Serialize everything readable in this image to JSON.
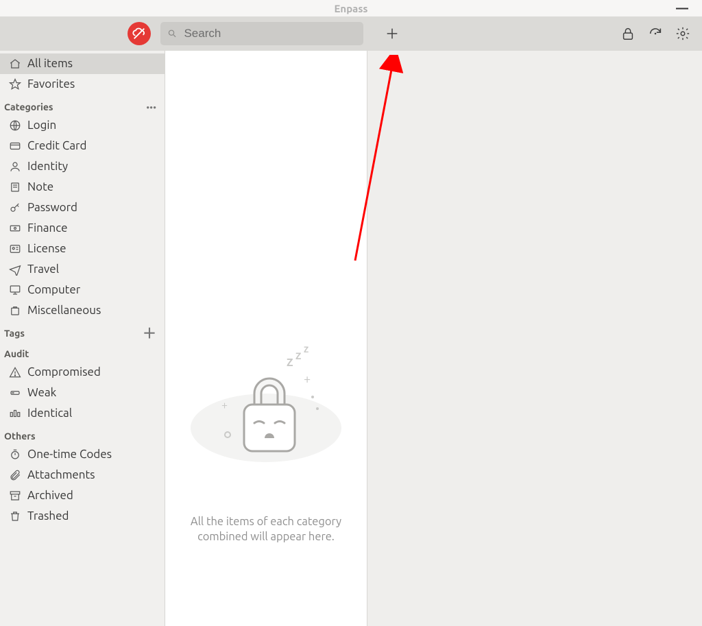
{
  "window": {
    "title": "Enpass"
  },
  "toolbar": {
    "search_placeholder": "Search"
  },
  "sidebar": {
    "top": [
      {
        "label": "All items",
        "icon": "home",
        "active": true
      },
      {
        "label": "Favorites",
        "icon": "star",
        "active": false
      }
    ],
    "sections": {
      "categories": {
        "label": "Categories",
        "items": [
          {
            "label": "Login",
            "icon": "globe"
          },
          {
            "label": "Credit Card",
            "icon": "card"
          },
          {
            "label": "Identity",
            "icon": "person"
          },
          {
            "label": "Note",
            "icon": "note"
          },
          {
            "label": "Password",
            "icon": "key"
          },
          {
            "label": "Finance",
            "icon": "banknote"
          },
          {
            "label": "License",
            "icon": "id"
          },
          {
            "label": "Travel",
            "icon": "plane"
          },
          {
            "label": "Computer",
            "icon": "monitor"
          },
          {
            "label": "Miscellaneous",
            "icon": "box"
          }
        ]
      },
      "tags": {
        "label": "Tags",
        "items": []
      },
      "audit": {
        "label": "Audit",
        "items": [
          {
            "label": "Compromised",
            "icon": "warning"
          },
          {
            "label": "Weak",
            "icon": "weak"
          },
          {
            "label": "Identical",
            "icon": "identical"
          }
        ]
      },
      "others": {
        "label": "Others",
        "items": [
          {
            "label": "One-time Codes",
            "icon": "timer"
          },
          {
            "label": "Attachments",
            "icon": "clip"
          },
          {
            "label": "Archived",
            "icon": "archive"
          },
          {
            "label": "Trashed",
            "icon": "trash"
          }
        ]
      }
    }
  },
  "empty": {
    "line1": "All the items of each category",
    "line2": "combined will appear here."
  }
}
